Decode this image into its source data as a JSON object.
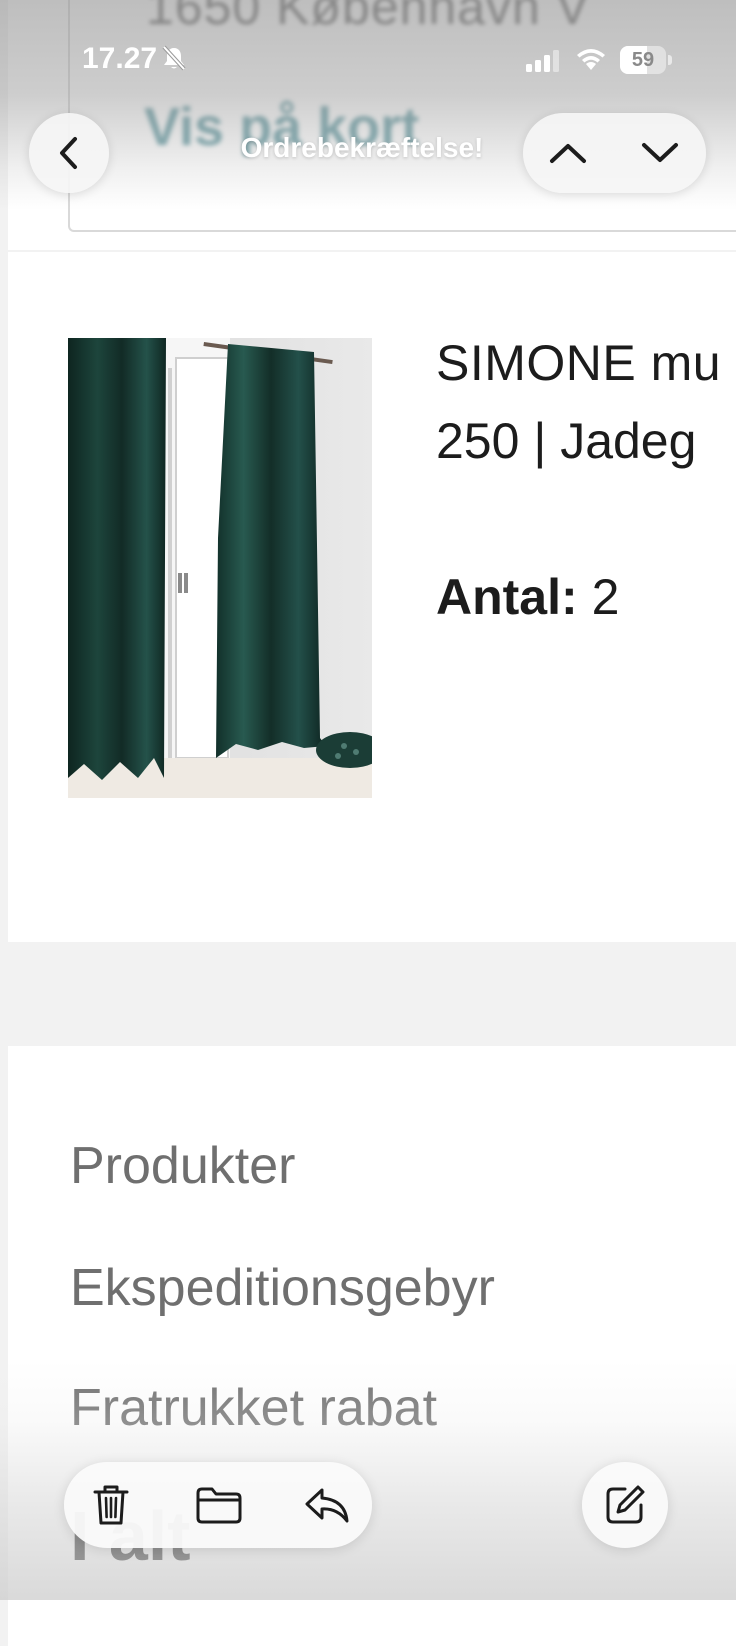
{
  "status_bar": {
    "time": "17.27",
    "battery_level": "59",
    "battery_fraction": 0.59
  },
  "nav": {
    "title": "Ordrebekræftelse!"
  },
  "email": {
    "address": {
      "line": "1650 København V",
      "map_link": "Vis på kort"
    },
    "product": {
      "name": "SIMONE mu",
      "variant": "250  |  Jadeg",
      "qty_label": "Antal:",
      "qty_value": "2"
    },
    "summary": {
      "products_label": "Produkter",
      "shipping_label": "Ekspeditionsgebyr",
      "discount_label": "Fratrukket rabat",
      "total_label": "I alt"
    }
  },
  "colors": {
    "accent_link": "#4d8c95",
    "text_primary": "#1c1c1c",
    "text_muted": "#6f6f6f",
    "curtain": "#17352f"
  },
  "icons": {
    "back": "chevron-left-icon",
    "up": "chevron-up-icon",
    "down": "chevron-down-icon",
    "trash": "trash-icon",
    "folder": "folder-icon",
    "reply": "reply-icon",
    "compose": "compose-icon",
    "bell": "bell-muted-icon",
    "signal": "signal-icon",
    "wifi": "wifi-icon"
  }
}
